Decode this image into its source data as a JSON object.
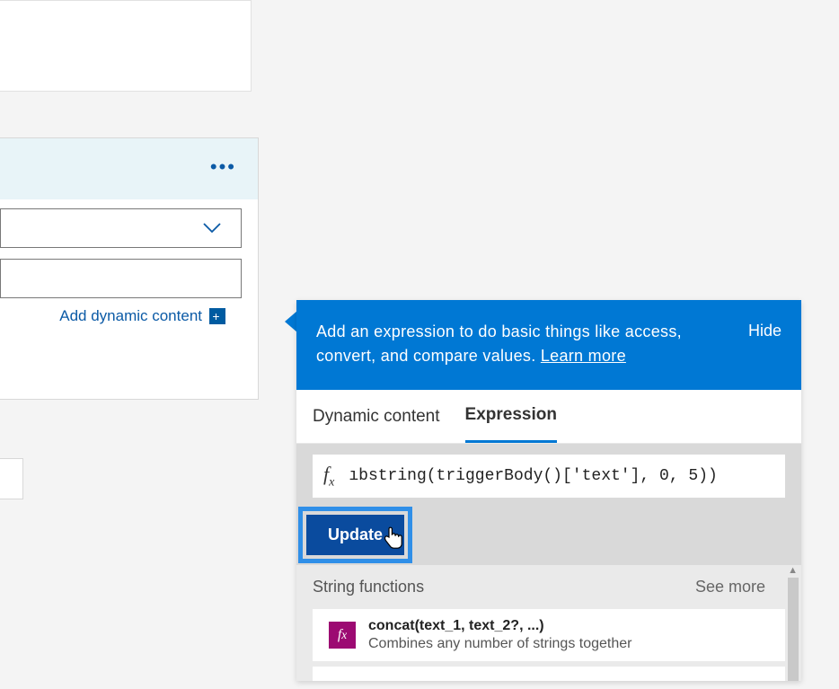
{
  "left_panel": {
    "add_dynamic_label": "Add dynamic content"
  },
  "panel": {
    "header_msg_1": "Add an expression to do basic things like access, convert, and compare values. ",
    "learn_more": "Learn more",
    "hide_label": "Hide",
    "tabs": {
      "dynamic": "Dynamic content",
      "expression": "Expression"
    },
    "expression_value": "ıbstring(triggerBody()['text'], 0, 5))",
    "update_label": "Update",
    "category": {
      "title": "String functions",
      "see_more": "See more"
    },
    "function": {
      "signature": "concat(text_1, text_2?, ...)",
      "description": "Combines any number of strings together"
    }
  }
}
